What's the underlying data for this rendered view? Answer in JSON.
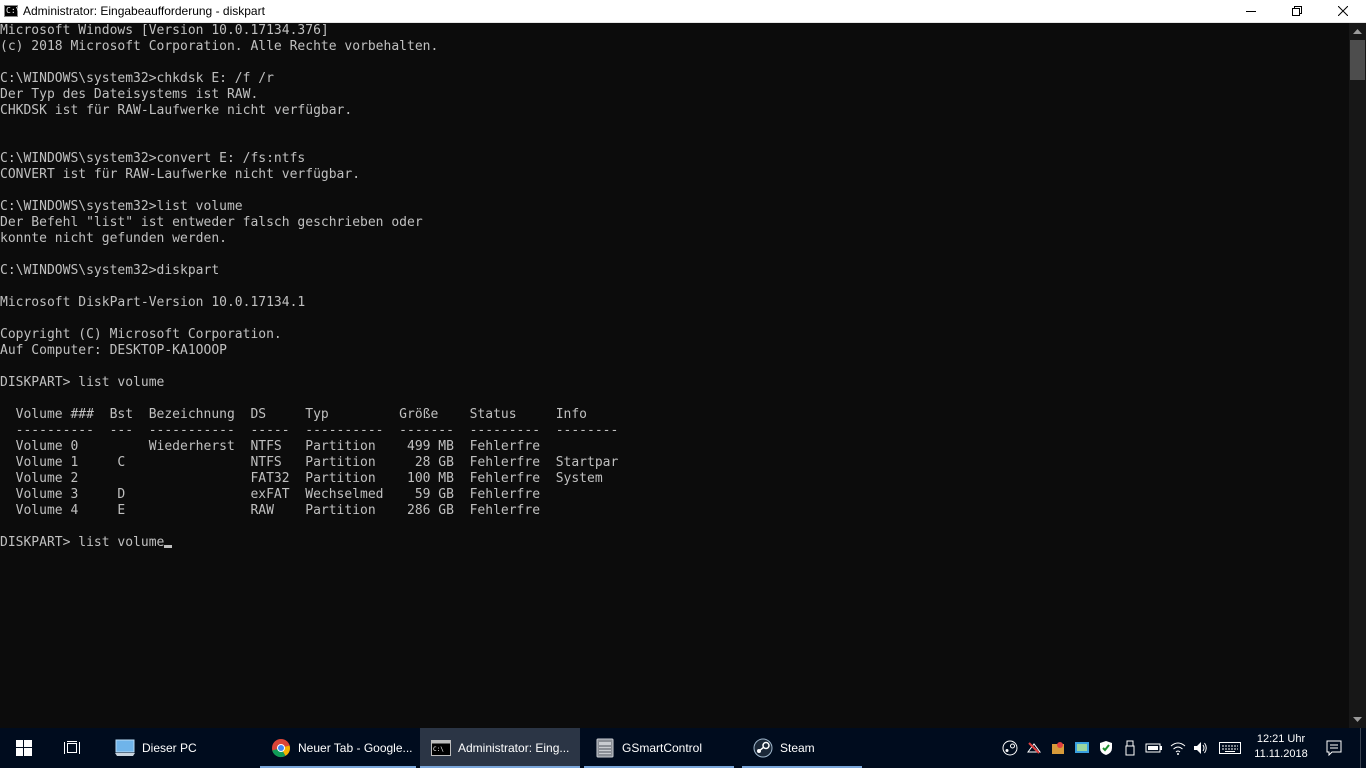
{
  "window": {
    "title": "Administrator: Eingabeaufforderung - diskpart",
    "icon": "cmd-icon"
  },
  "console": {
    "lines": [
      "Microsoft Windows [Version 10.0.17134.376]",
      "(c) 2018 Microsoft Corporation. Alle Rechte vorbehalten.",
      "",
      "C:\\WINDOWS\\system32>chkdsk E: /f /r",
      "Der Typ des Dateisystems ist RAW.",
      "CHKDSK ist für RAW-Laufwerke nicht verfügbar.",
      "",
      "",
      "C:\\WINDOWS\\system32>convert E: /fs:ntfs",
      "CONVERT ist für RAW-Laufwerke nicht verfügbar.",
      "",
      "C:\\WINDOWS\\system32>list volume",
      "Der Befehl \"list\" ist entweder falsch geschrieben oder",
      "konnte nicht gefunden werden.",
      "",
      "C:\\WINDOWS\\system32>diskpart",
      "",
      "Microsoft DiskPart-Version 10.0.17134.1",
      "",
      "Copyright (C) Microsoft Corporation.",
      "Auf Computer: DESKTOP-KA1OOOP",
      "",
      "DISKPART> list volume",
      "",
      "  Volume ###  Bst  Bezeichnung  DS     Typ         Größe    Status     Info",
      "  ----------  ---  -----------  -----  ----------  -------  ---------  --------",
      "  Volume 0         Wiederherst  NTFS   Partition    499 MB  Fehlerfre",
      "  Volume 1     C                NTFS   Partition     28 GB  Fehlerfre  Startpar",
      "  Volume 2                      FAT32  Partition    100 MB  Fehlerfre  System",
      "  Volume 3     D                exFAT  Wechselmed    59 GB  Fehlerfre",
      "  Volume 4     E                RAW    Partition    286 GB  Fehlerfre",
      ""
    ],
    "current_input": "DISKPART> list volume",
    "colors": {
      "background": "#0c0c0c",
      "text": "#c0c0c0"
    }
  },
  "taskbar": {
    "items": [
      {
        "label": "Dieser PC",
        "icon": "this-pc-icon"
      },
      {
        "label": "Neuer Tab - Google...",
        "icon": "chrome-icon"
      },
      {
        "label": "Administrator: Eing...",
        "icon": "cmd-icon"
      },
      {
        "label": "GSmartControl",
        "icon": "drive-icon"
      },
      {
        "label": "Steam",
        "icon": "steam-icon"
      }
    ],
    "clock": {
      "time": "12:21 Uhr",
      "date": "11.11.2018"
    },
    "colors": {
      "background": "#000c1e",
      "active": "#2b3545",
      "running_indicator": "#7aa6da"
    }
  }
}
